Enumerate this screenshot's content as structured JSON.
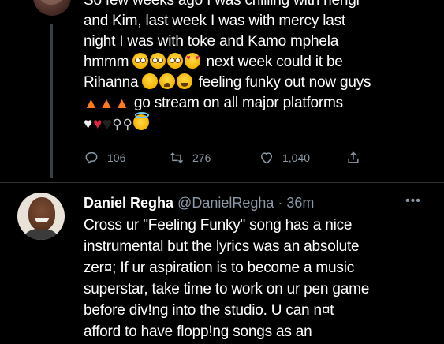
{
  "tweet1": {
    "lines": [
      "So few weeks ago I was chilling with nengi",
      "and Kim, last week I was with mercy last",
      "night I was with toke and Kamo mphela",
      "hmmm",
      "next week could it be",
      "Rihanna",
      "feeling funky out now guys",
      "go stream on all major platforms"
    ],
    "stats": {
      "replies": "106",
      "retweets": "276",
      "likes": "1,040"
    }
  },
  "tweet2": {
    "display_name": "Daniel Regha",
    "handle": "@DanielRegha",
    "separator": " · ",
    "time": "36m",
    "lines": [
      "Cross ur \"Feeling Funky\" song has a nice",
      "instrumental but the lyrics was an absolute",
      "zer¤; If ur aspiration is to become a  music",
      "superstar, take time to work on ur pen game",
      "before div!ng into the studio. U can n¤t",
      "afford to have flopp!ng songs as an"
    ]
  },
  "icons": {
    "reply": "reply-icon",
    "retweet": "retweet-icon",
    "like": "heart-icon",
    "share": "share-icon",
    "more": "more-icon"
  },
  "colors": {
    "background": "#000000",
    "text": "#ffffff",
    "muted": "#8b98a5",
    "divider": "#2f3336"
  }
}
